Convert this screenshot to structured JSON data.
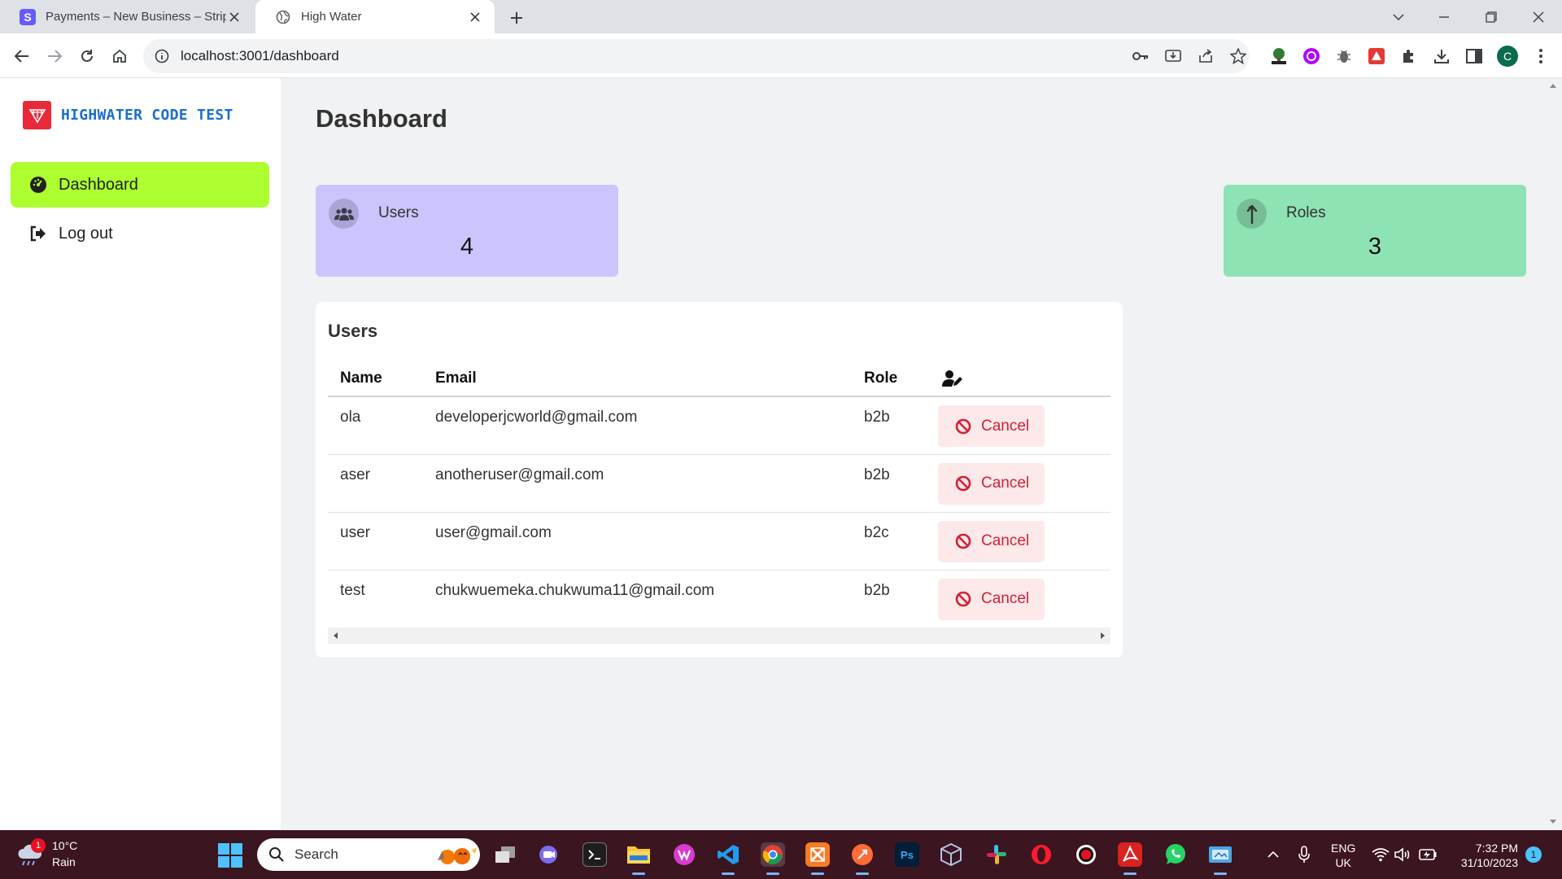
{
  "browser": {
    "tabs": [
      {
        "title": "Payments – New Business – Strip",
        "favicon": "S"
      },
      {
        "title": "High Water",
        "favicon": "globe-icon"
      }
    ],
    "url": "localhost:3001/dashboard",
    "profile_initial": "C"
  },
  "sidebar": {
    "brand": "HIGHWATER CODE TEST",
    "items": [
      {
        "label": "Dashboard",
        "icon": "gauge-icon",
        "active": true
      },
      {
        "label": "Log out",
        "icon": "logout-icon",
        "active": false
      }
    ],
    "active_color": "#adff2f"
  },
  "main": {
    "title": "Dashboard",
    "stats": [
      {
        "label": "Users",
        "value": "4",
        "color": "#cbc5fd",
        "icon": "users-icon"
      },
      {
        "label": "Roles",
        "value": "3",
        "color": "#8ee3b4",
        "icon": "arrow-up-icon"
      }
    ],
    "users_panel": {
      "title": "Users",
      "columns": [
        "Name",
        "Email",
        "Role"
      ],
      "action_column_icon": "user-edit-icon",
      "rows": [
        {
          "name": "ola",
          "email": "developerjcworld@gmail.com",
          "role": "b2b",
          "action": "Cancel"
        },
        {
          "name": "aser",
          "email": "anotheruser@gmail.com",
          "role": "b2b",
          "action": "Cancel"
        },
        {
          "name": "user",
          "email": "user@gmail.com",
          "role": "b2c",
          "action": "Cancel"
        },
        {
          "name": "test",
          "email": "chukwuemeka.chukwuma11@gmail.com",
          "role": "b2b",
          "action": "Cancel"
        }
      ]
    }
  },
  "taskbar": {
    "weather": {
      "temp": "10°C",
      "desc": "Rain",
      "badge": "1"
    },
    "search_placeholder": "Search",
    "language": {
      "line1": "ENG",
      "line2": "UK"
    },
    "clock": {
      "time": "7:32 PM",
      "date": "31/10/2023"
    },
    "notification_count": "1"
  }
}
